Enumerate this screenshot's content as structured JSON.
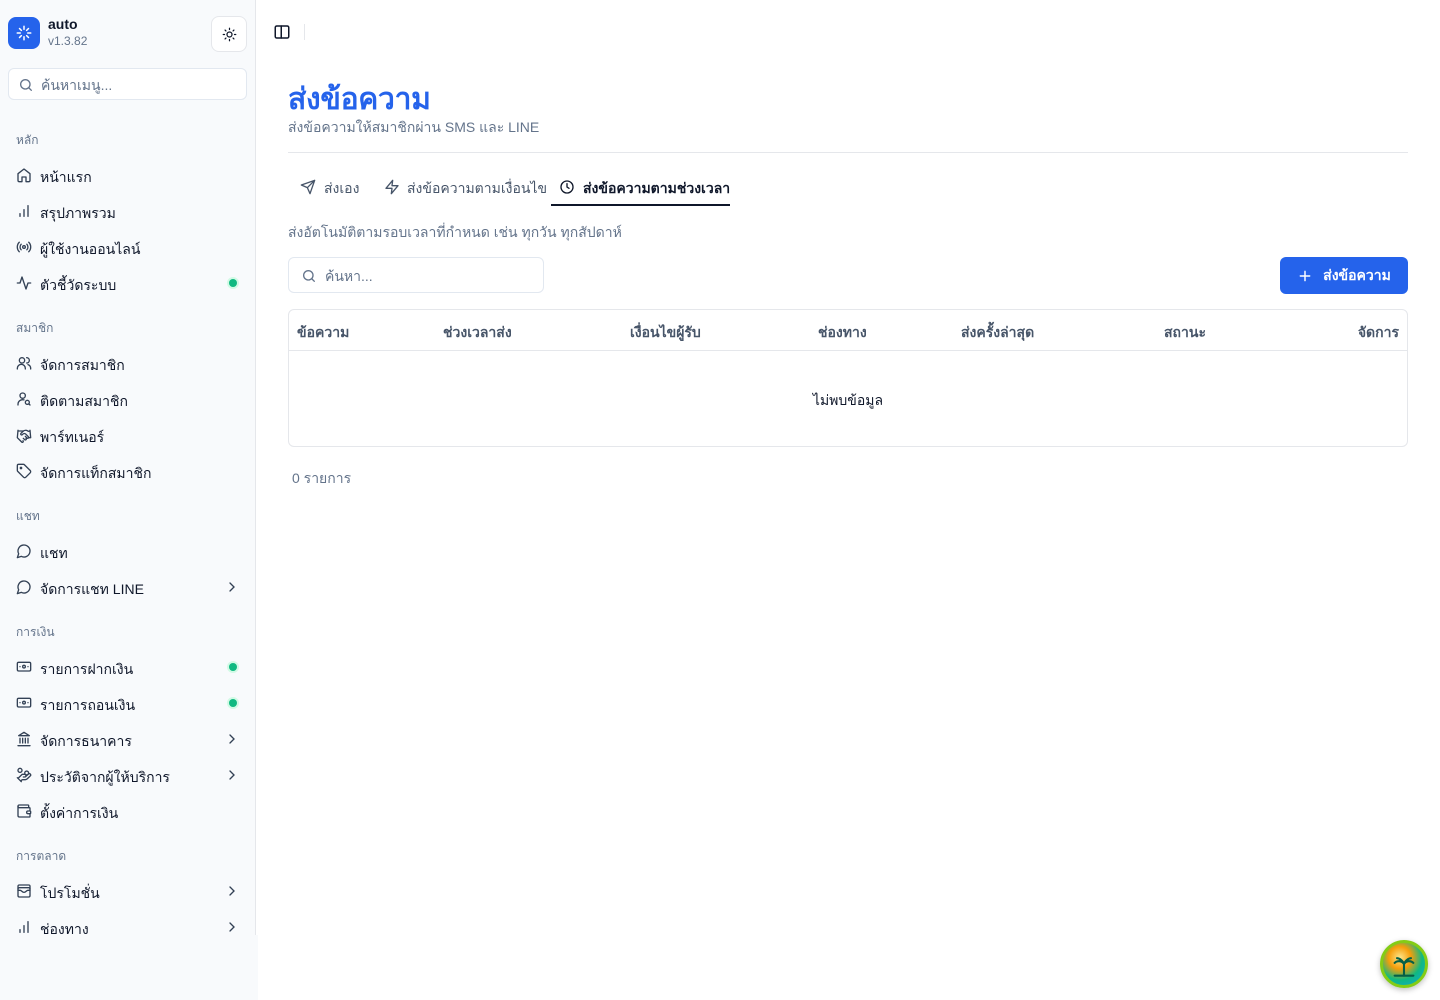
{
  "app": {
    "name": "auto",
    "version": "v1.3.82"
  },
  "sidebar": {
    "search_placeholder": "ค้นหาเมนู...",
    "sections": [
      {
        "title": "หลัก",
        "items": [
          {
            "label": "หน้าแรก",
            "icon": "home-icon"
          },
          {
            "label": "สรุปภาพรวม",
            "icon": "bar-chart-icon"
          },
          {
            "label": "ผู้ใช้งานออนไลน์",
            "icon": "radio-icon"
          },
          {
            "label": "ตัวชี้วัดระบบ",
            "icon": "activity-icon",
            "status_dot": true
          }
        ]
      },
      {
        "title": "สมาชิก",
        "items": [
          {
            "label": "จัดการสมาชิก",
            "icon": "users-icon"
          },
          {
            "label": "ติดตามสมาชิก",
            "icon": "user-search-icon"
          },
          {
            "label": "พาร์ทเนอร์",
            "icon": "handshake-icon"
          },
          {
            "label": "จัดการแท็กสมาชิก",
            "icon": "tag-icon"
          }
        ]
      },
      {
        "title": "แชท",
        "items": [
          {
            "label": "แชท",
            "icon": "message-circle-icon"
          },
          {
            "label": "จัดการแชท LINE",
            "icon": "message-circle-icon",
            "chevron": true
          }
        ]
      },
      {
        "title": "การเงิน",
        "items": [
          {
            "label": "รายการฝากเงิน",
            "icon": "deposit-icon",
            "status_dot": true
          },
          {
            "label": "รายการถอนเงิน",
            "icon": "withdraw-icon",
            "status_dot": true
          },
          {
            "label": "จัดการธนาคาร",
            "icon": "bank-icon",
            "chevron": true
          },
          {
            "label": "ประวัติจากผู้ให้บริการ",
            "icon": "hand-coins-icon",
            "chevron": true
          },
          {
            "label": "ตั้งค่าการเงิน",
            "icon": "wallet-icon"
          }
        ]
      },
      {
        "title": "การตลาด",
        "items": [
          {
            "label": "โปรโมชั่น",
            "icon": "wallet-cards-icon",
            "chevron": true
          },
          {
            "label": "ช่องทาง",
            "icon": "bar-chart-icon",
            "chevron": true
          }
        ]
      }
    ]
  },
  "page": {
    "title": "ส่งข้อความ",
    "subtitle": "ส่งข้อความให้สมาชิกผ่าน SMS และ LINE",
    "tabs": [
      {
        "label": "ส่งเอง",
        "icon": "send-icon"
      },
      {
        "label": "ส่งข้อความตามเงื่อนไข",
        "icon": "zap-icon"
      },
      {
        "label": "ส่งข้อความตามช่วงเวลา",
        "icon": "clock-icon",
        "active": true
      }
    ],
    "tab_description": "ส่งอัตโนมัติตามรอบเวลาที่กำหนด เช่น ทุกวัน ทุกสัปดาห์",
    "search_placeholder": "ค้นหา...",
    "add_button_label": "ส่งข้อความ",
    "table": {
      "columns": [
        "ข้อความ",
        "ช่วงเวลาส่ง",
        "เงื่อนไขผู้รับ",
        "ช่องทาง",
        "ส่งครั้งล่าสุด",
        "สถานะ",
        "จัดการ"
      ],
      "rows": [],
      "empty_text": "ไม่พบข้อมูล"
    },
    "record_count": "0 รายการ"
  },
  "colors": {
    "accent": "#2563eb",
    "status_dot": "#10b981"
  }
}
